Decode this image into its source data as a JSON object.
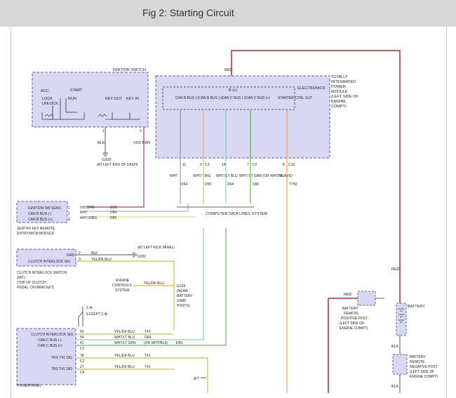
{
  "header": {
    "title": "Fig 2: Starting Circuit"
  },
  "colors": {
    "red": "#cc2222",
    "violet": "#aa3399",
    "blk": "#555555",
    "green": "#44aa33",
    "yellow": "#ddbb33",
    "teal": "#66ccbb",
    "orange": "#f0a040",
    "module_fill": "#d8d8f4",
    "module_stroke": "#6666aa"
  },
  "ignition": {
    "title": "IGNITION SWITCH",
    "acc": "ACC",
    "lock": "LOCK",
    "unlock": "UNLOCK",
    "start": "START",
    "run": "RUN",
    "key_out": "KEY OUT",
    "key_in": "KEY IN",
    "pin1": "1",
    "pin2": "2",
    "blk": "BLK",
    "vio_brn": "VIO/ BRN",
    "ground": "G200",
    "ground_note": "(AT LEFT END OF DASH)"
  },
  "tipm": {
    "red": "RED",
    "b_plus": "B (+)",
    "electronics": "ELECTRONICS",
    "title": "TOTALLY INTEGRATED POWER MODULE (LEFT SIDE OF ENGINE COMPT)",
    "cols": [
      "CAN B BUS (-)",
      "CAN B BUS (+)",
      "CAN C BUS (-)",
      "CAN C BUS (+)",
      "STARTER CTRL OUT"
    ],
    "pins": [
      "11",
      "3",
      "14",
      "7",
      "8"
    ],
    "connectors": [
      "C3",
      "C2",
      "C10"
    ],
    "wires": [
      "WHT",
      "WHT/ ORG",
      "WHT/ LT BLU",
      "WHT/ LT GRN (OR WHT/ BLK)",
      "YEL/ VIO"
    ],
    "circuits": [
      "D54",
      "D55",
      "D64",
      "D65",
      "T750"
    ]
  },
  "data_lines": "COMPUTER DATA LINES SYSTEM",
  "sentry": {
    "rows": [
      "IGNITION SW SENS",
      "CAN B BUS (-)",
      "CAN B BUS (+)"
    ],
    "pins": [
      "1",
      "2",
      "3"
    ],
    "wires": [
      "VIO/BRN",
      "WHT",
      "WHT/ORG"
    ],
    "circuits": [
      "G20",
      "D54",
      "D55"
    ],
    "title": "SENTRY KEY REMOTE ENTRY/WCM MODULE"
  },
  "clutch": {
    "rows": [
      "GND",
      "CLUTCH INTERLOCK SIG"
    ],
    "pins": [
      "2",
      "3"
    ],
    "wires": [
      "BLK",
      "YEL/DK BLU"
    ],
    "ground": "G302",
    "ground_note": "(AT LEFT KICK PANEL)",
    "title": "CLUTCH INTERLOCK SWITCH (M/T) (TOP OF CLUTCH PEDAL, ON BRACKET)"
  },
  "engine_controls": {
    "label": "ENGINE CONTROLS SYSTEM",
    "wire": "YEL/DK BLU",
    "splice": "G128",
    "splice_note": "(NEAR BATTERY JUMP POSTS)"
  },
  "pcm": {
    "rows": [
      "CLUTCH INTERLOCK SIG",
      "CAN C BUS (-)",
      "CAN C BUS (+)",
      "TRS T41 SIG",
      "TRS T41 SIG"
    ],
    "pins": [
      "50",
      "54",
      "41",
      "78",
      "27"
    ],
    "connectors": [
      "C1",
      "C2",
      "C4"
    ],
    "wires": [
      "YEL/DK BLU",
      "WHT/LT BLU",
      "WHT/LT GRN",
      "YEL/DK BLU",
      "YEL/DK BLU"
    ],
    "circuits": [
      "T41",
      "D64",
      "D65",
      "T41",
      "T41"
    ],
    "or_label": "(OR WHT/BLK)",
    "engine_24": "2.4L",
    "except_24": "EXCEPT 2.4L",
    "title": "POWERTRAIN"
  },
  "at_label": "A/T",
  "battery": {
    "red1": "RED",
    "red2": "RED",
    "label": "BATTERY",
    "pos_post": "BATTERY REMOTE POSITIVE POST (LEFT SIDE OF ENGINE COMPT)",
    "neg_post": "BATTERY REMOTE NEGATIVE POST (LEFT SIDE OF ENGINE COMPT)",
    "blk1": "BLK",
    "blk2": "BLK"
  }
}
